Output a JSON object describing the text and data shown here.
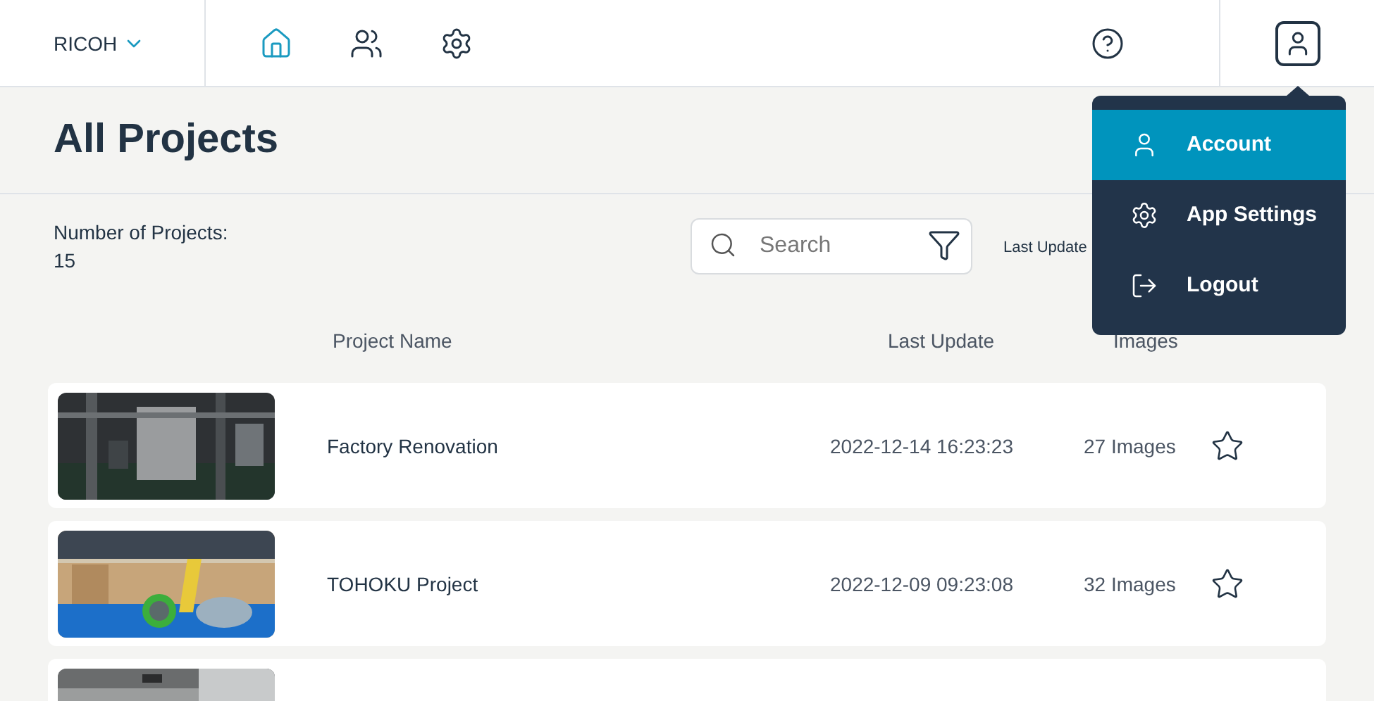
{
  "header": {
    "brand": "RICOH",
    "nav": [
      {
        "kind": "home",
        "selected": true
      },
      {
        "kind": "people",
        "selected": false
      },
      {
        "kind": "settings",
        "selected": false
      }
    ]
  },
  "title": "All Projects",
  "stats": {
    "label": "Number of Projects:",
    "value": "15"
  },
  "search": {
    "placeholder": "Search"
  },
  "sort_label": "Last Update",
  "columns": [
    "Project Name",
    "Last Update",
    "Images"
  ],
  "projects": [
    {
      "kind": "full",
      "name": "Factory Renovation",
      "updated": "2022-12-14 16:23:23",
      "images": "27 Images",
      "starred": false
    },
    {
      "kind": "full",
      "name": "TOHOKU Project",
      "updated": "2022-12-09 09:23:08",
      "images": "32 Images",
      "starred": false
    },
    {
      "kind": "partial"
    }
  ],
  "menu": [
    {
      "kind": "account",
      "label": "Account",
      "selected": true
    },
    {
      "kind": "settings",
      "label": "App Settings",
      "selected": false
    },
    {
      "kind": "logout",
      "label": "Logout",
      "selected": false
    }
  ]
}
